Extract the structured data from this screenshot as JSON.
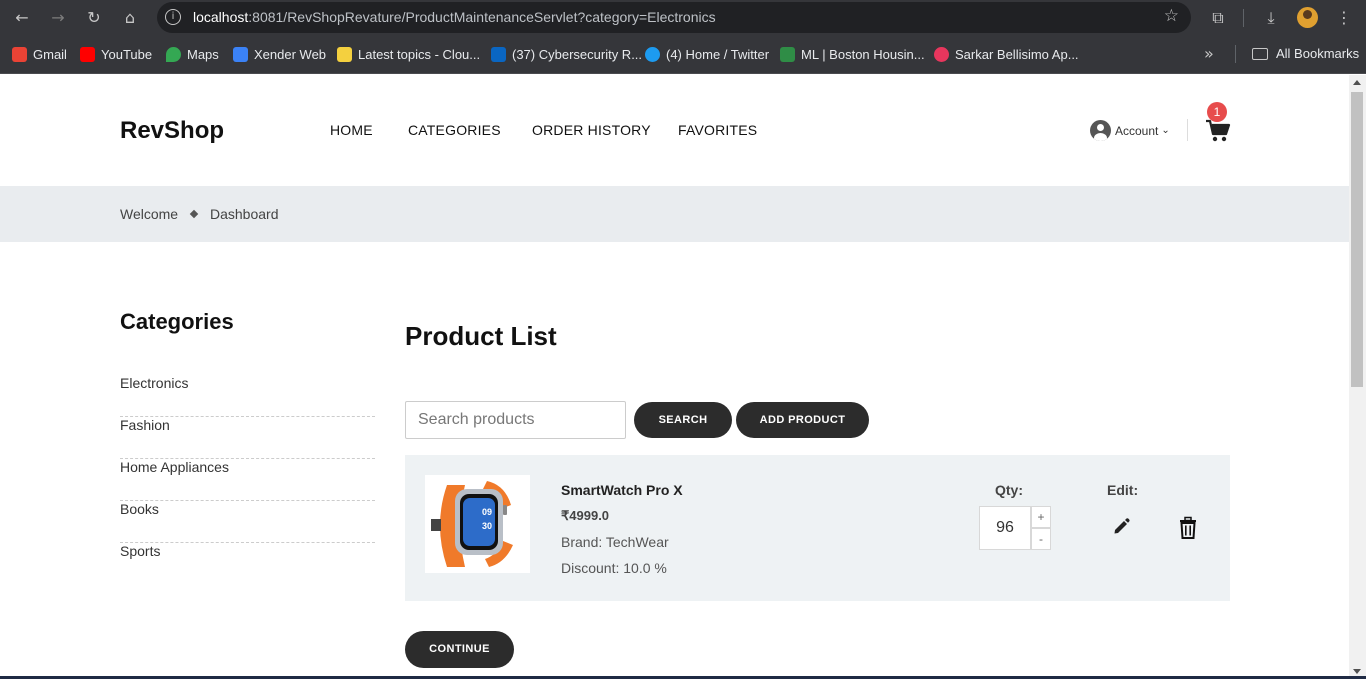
{
  "browser": {
    "url_host": "localhost",
    "url_rest": ":8081/RevShopRevature/ProductMaintenanceServlet?category=Electronics",
    "bookmarks": [
      {
        "label": "Gmail",
        "color": "#ea4335"
      },
      {
        "label": "YouTube",
        "color": "#ff0000"
      },
      {
        "label": "Maps",
        "color": "#34a853"
      },
      {
        "label": "Xender Web",
        "color": "#3b82f6"
      },
      {
        "label": "Latest topics - Clou...",
        "color": "#f4d03f"
      },
      {
        "label": "(37) Cybersecurity R...",
        "color": "#0a66c2"
      },
      {
        "label": "(4) Home / Twitter",
        "color": "#1d9bf0"
      },
      {
        "label": "ML | Boston Housin...",
        "color": "#2f8d46"
      },
      {
        "label": "Sarkar Bellisimo Ap...",
        "color": "#e8365d"
      }
    ],
    "all_bookmarks_label": "All Bookmarks"
  },
  "header": {
    "logo": "RevShop",
    "nav": [
      "HOME",
      "CATEGORIES",
      "ORDER HISTORY",
      "FAVORITES"
    ],
    "account_label": "Account",
    "cart_count": "1"
  },
  "breadcrumb": {
    "items": [
      "Welcome",
      "Dashboard"
    ]
  },
  "sidebar": {
    "title": "Categories",
    "items": [
      "Electronics",
      "Fashion",
      "Home Appliances",
      "Books",
      "Sports"
    ]
  },
  "main": {
    "title": "Product List",
    "search_placeholder": "Search products",
    "search_button": "SEARCH",
    "add_button": "ADD PRODUCT",
    "continue_button": "CONTINUE",
    "products": [
      {
        "name": "SmartWatch Pro X",
        "price": "₹4999.0",
        "brand": "Brand: TechWear",
        "discount": "Discount: 10.0 %",
        "qty_label": "Qty:",
        "qty": "96",
        "edit_label": "Edit:",
        "watch_hour": "09",
        "watch_min": "30"
      }
    ]
  }
}
